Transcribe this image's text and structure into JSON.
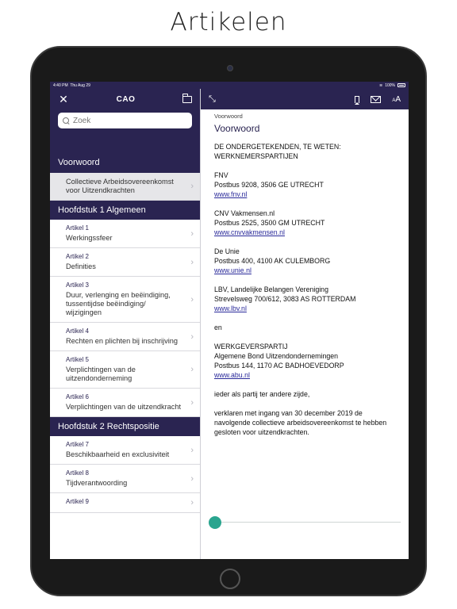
{
  "promo": {
    "title": "Artikelen"
  },
  "status": {
    "time": "4:40 PM",
    "date": "Thu Aug 29",
    "battery": "100%"
  },
  "sidebar": {
    "title": "CAO",
    "search_placeholder": "Zoek",
    "sections": [
      {
        "title": "Voorwoord",
        "items": [
          {
            "article": "",
            "label": "Collectieve Arbeidsovereenkomst voor Uitzendkrachten",
            "selected": true
          }
        ]
      },
      {
        "title": "Hoofdstuk 1 Algemeen",
        "items": [
          {
            "article": "Artikel 1",
            "label": "Werkingssfeer"
          },
          {
            "article": "Artikel 2",
            "label": "Definities"
          },
          {
            "article": "Artikel 3",
            "label": "Duur, verlenging en beëindiging, tussentijdse beëindiging/ wijzigingen"
          },
          {
            "article": "Artikel 4",
            "label": "Rechten en plichten bij inschrijving"
          },
          {
            "article": "Artikel 5",
            "label": "Verplichtingen van de uitzendonderneming"
          },
          {
            "article": "Artikel 6",
            "label": "Verplichtingen van de uitzendkracht"
          }
        ]
      },
      {
        "title": "Hoofdstuk 2 Rechtspositie",
        "items": [
          {
            "article": "Artikel 7",
            "label": "Beschikbaarheid en exclusiviteit"
          },
          {
            "article": "Artikel 8",
            "label": "Tijdverantwoording"
          },
          {
            "article": "Artikel 9",
            "label": ""
          }
        ]
      }
    ]
  },
  "content": {
    "breadcrumb": "Voorwoord",
    "title": "Voorwoord",
    "paragraphs": [
      {
        "lines": [
          "DE ONDERGETEKENDEN, TE WETEN:",
          "WERKNEMERSPARTIJEN"
        ]
      },
      {
        "lines": [
          "FNV",
          "Postbus 9208, 3506 GE UTRECHT"
        ],
        "link": "www.fnv.nl"
      },
      {
        "lines": [
          "CNV Vakmensen.nl",
          "Postbus 2525, 3500 GM UTRECHT"
        ],
        "link": "www.cnvvakmensen.nl"
      },
      {
        "lines": [
          "De Unie",
          "Postbus 400, 4100 AK CULEMBORG"
        ],
        "link": "www.unie.nl"
      },
      {
        "lines": [
          "LBV, Landelijke Belangen Vereniging",
          "Strevelsweg 700/612, 3083 AS ROTTERDAM"
        ],
        "link": "www.lbv.nl"
      },
      {
        "lines": [
          "en"
        ]
      },
      {
        "lines": [
          "WERKGEVERSPARTIJ",
          "Algemene Bond Uitzendondernemingen",
          "Postbus 144, 1170 AC BADHOEVEDORP"
        ],
        "link": "www.abu.nl"
      },
      {
        "lines": [
          "ieder als partij ter andere zijde,"
        ]
      },
      {
        "lines": [
          "verklaren met ingang van 30 december 2019 de navolgende collectieve arbeidsovereenkomst te hebben gesloten voor uitzendkrachten."
        ]
      }
    ],
    "font_icon": {
      "small": "A",
      "large": "A"
    },
    "slider_value": 0
  },
  "colors": {
    "brand": "#2a2451",
    "accent": "#2aa58f",
    "link": "#2a2a9a"
  },
  "icons": {
    "close": "close-icon",
    "folder": "folder-icon",
    "expand": "expand-icon",
    "bookmark": "bookmark-icon",
    "mail": "mail-icon",
    "font_size": "font-size-icon",
    "search": "search-icon",
    "chevron": "chevron-right-icon"
  }
}
